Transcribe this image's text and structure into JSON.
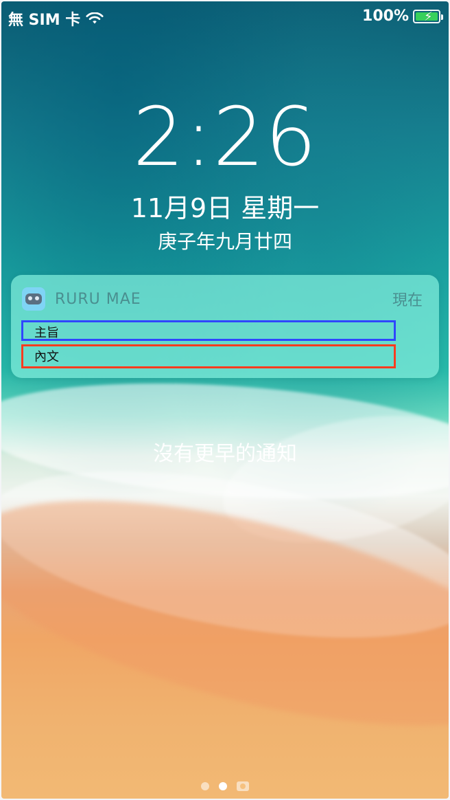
{
  "status_bar": {
    "carrier": "無 SIM 卡",
    "battery_percent": "100%",
    "battery_level": 1.0
  },
  "lock_screen": {
    "time": "2:26",
    "date": "11月9日 星期一",
    "lunar_date": "庚子年九月廿四",
    "no_earlier_notifications": "沒有更早的通知"
  },
  "notification": {
    "app_name": "RURU MAE",
    "time": "現在",
    "subject": "主旨",
    "body": "內文"
  },
  "page_indicator": {
    "active_index": 1
  }
}
